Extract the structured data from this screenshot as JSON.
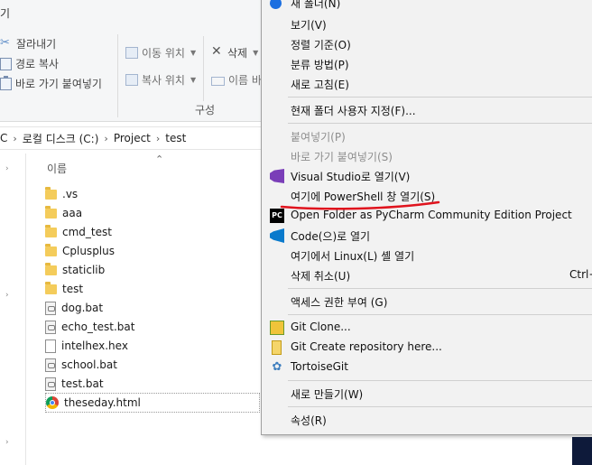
{
  "ribbon": {
    "tab_partial": "기",
    "clipboard": {
      "cut": "잘라내기",
      "copy_path": "경로 복사",
      "paste_shortcut": "바로 가기 붙여넣기"
    },
    "organize": {
      "move_to": "이동 위치",
      "copy_to": "복사 위치",
      "delete": "삭제",
      "rename_partial": "이름 바",
      "group_label": "구성"
    }
  },
  "address": {
    "crumbs": [
      "C",
      "로컬 디스크 (C:)",
      "Project",
      "test"
    ]
  },
  "file_list": {
    "column_name": "이름",
    "items": [
      {
        "name": ".vs",
        "type": "folder"
      },
      {
        "name": "aaa",
        "type": "folder"
      },
      {
        "name": "cmd_test",
        "type": "folder"
      },
      {
        "name": "Cplusplus",
        "type": "folder"
      },
      {
        "name": "staticlib",
        "type": "folder"
      },
      {
        "name": "test",
        "type": "folder"
      },
      {
        "name": "dog.bat",
        "type": "bat"
      },
      {
        "name": "echo_test.bat",
        "type": "bat"
      },
      {
        "name": "intelhex.hex",
        "type": "hex"
      },
      {
        "name": "school.bat",
        "type": "bat"
      },
      {
        "name": "test.bat",
        "type": "bat"
      },
      {
        "name": "theseday.html",
        "type": "chrome"
      }
    ]
  },
  "context_menu": {
    "items": [
      {
        "label": "새 폴더(N)",
        "icon": "new-folder-icon"
      },
      {
        "label": "보기(V)"
      },
      {
        "label": "정렬 기준(O)"
      },
      {
        "label": "분류 방법(P)"
      },
      {
        "label": "새로 고침(E)"
      },
      {
        "label": "현재 폴더 사용자 지정(F)..."
      },
      {
        "label": "붙여넣기(P)",
        "disabled": true
      },
      {
        "label": "바로 가기 붙여넣기(S)",
        "disabled": true
      },
      {
        "label": "Visual Studio로 열기(V)",
        "icon": "visual-studio-icon"
      },
      {
        "label": "여기에 PowerShell 창 열기(S)"
      },
      {
        "label": "Open Folder as PyCharm Community Edition Project",
        "icon": "pycharm-icon"
      },
      {
        "label": "Code(으)로 열기",
        "icon": "vscode-icon"
      },
      {
        "label": "여기에서 Linux(L) 셸 열기"
      },
      {
        "label": "삭제 취소(U)",
        "shortcut": "Ctrl+"
      },
      {
        "label": "액세스 권한 부여 (G)"
      },
      {
        "label": "Git Clone...",
        "icon": "git-clone-icon"
      },
      {
        "label": "Git Create repository here...",
        "icon": "git-create-icon"
      },
      {
        "label": "TortoiseGit",
        "icon": "tortoisegit-icon"
      },
      {
        "label": "새로 만들기(W)"
      },
      {
        "label": "속성(R)"
      }
    ],
    "pycharm_icon_text": "PC"
  },
  "colors": {
    "annotation": "#e0141e",
    "menu_bg": "#f2f2f2",
    "folder": "#f4cc5b"
  }
}
